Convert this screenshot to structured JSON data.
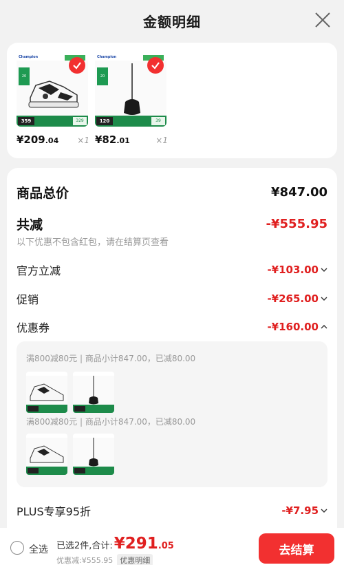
{
  "header": {
    "title": "金额明细"
  },
  "products": [
    {
      "price_main": "¥209",
      "price_cents": ".04",
      "qty": "×1",
      "tag_left": "359",
      "tag_right": "329",
      "badge": "20"
    },
    {
      "price_main": "¥82",
      "price_cents": ".01",
      "qty": "×1",
      "tag_left": "120",
      "tag_right": "39",
      "badge": "20"
    }
  ],
  "thumb_logo": "Champion",
  "summary_rows": {
    "total_label": "商品总价",
    "total_value": "¥847.00",
    "reduce_label": "共减",
    "reduce_value": "-¥555.95",
    "note": "以下优惠不包含红包，请在结算页查看",
    "official_label": "官方立减",
    "official_value": "-¥103.00",
    "promo_label": "促销",
    "promo_value": "-¥265.00",
    "coupon_label": "优惠券",
    "coupon_value": "-¥160.00",
    "plus_label": "PLUS专享95折",
    "plus_value": "-¥7.95"
  },
  "coupons": [
    {
      "text": "满800减80元 | 商品小计847.00，已减80.00"
    },
    {
      "text": "满800减80元 | 商品小计847.00，已减80.00"
    }
  ],
  "bottom": {
    "select_all": "全选",
    "selected_text": "已选2件,合计:",
    "total_main": "¥291",
    "total_cents": ".05",
    "discount_text": "优惠减:¥555.95",
    "detail_tag": "优惠明细",
    "checkout": "去结算"
  },
  "colors": {
    "accent": "#e02020",
    "button": "#f23030",
    "green": "#1d8b4a"
  }
}
